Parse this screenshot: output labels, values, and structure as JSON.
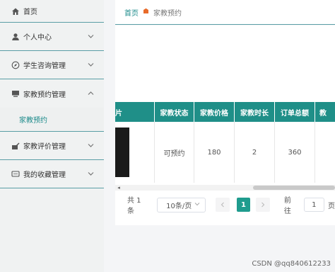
{
  "sidebar": {
    "home": {
      "label": "首页",
      "icon": "home-icon"
    },
    "items": [
      {
        "label": "个人中心",
        "icon": "user-icon"
      },
      {
        "label": "学生咨询管理",
        "icon": "compass-icon"
      },
      {
        "label": "家教预约管理",
        "icon": "monitor-icon",
        "open": true,
        "children": [
          {
            "label": "家教预约"
          }
        ]
      },
      {
        "label": "家教评价管理",
        "icon": "edit-icon"
      },
      {
        "label": "我的收藏管理",
        "icon": "comment-icon"
      }
    ]
  },
  "breadcrumb": {
    "home": "首页",
    "current": "家教预约"
  },
  "table": {
    "headers": [
      "片",
      "家教状态",
      "家教价格",
      "家教时长",
      "订单总额",
      "教"
    ],
    "row": [
      "",
      "可预约",
      "180",
      "2",
      "360",
      ""
    ]
  },
  "pagination": {
    "total": "共 1 条",
    "page_size": "10条/页",
    "current_page": "1",
    "goto_label": "前往",
    "goto_value": "1",
    "page_unit": "页"
  },
  "watermark": "CSDN @qq840612233",
  "colors": {
    "accent": "#1f8f88",
    "active_page": "#1f9c8e",
    "breadcrumb_separator": "#e86b2a"
  }
}
